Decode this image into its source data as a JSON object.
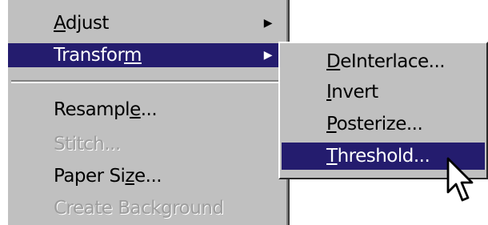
{
  "main_menu": {
    "items": [
      {
        "label": "Adjust",
        "has_submenu": true,
        "state": "normal"
      },
      {
        "label": "Transform",
        "has_submenu": true,
        "state": "selected"
      },
      {
        "label": "Resample...",
        "has_submenu": false,
        "state": "normal"
      },
      {
        "label": "Stitch...",
        "has_submenu": false,
        "state": "disabled"
      },
      {
        "label": "Paper Size...",
        "has_submenu": false,
        "state": "normal"
      },
      {
        "label": "Create Background",
        "has_submenu": false,
        "state": "disabled"
      }
    ]
  },
  "submenu": {
    "items": [
      {
        "label": "DeInterlace...",
        "state": "normal"
      },
      {
        "label": "Invert",
        "state": "normal"
      },
      {
        "label": "Posterize...",
        "state": "normal"
      },
      {
        "label": "Threshold...",
        "state": "selected"
      }
    ]
  },
  "icons": {
    "submenu_arrow": "triangle-right-icon",
    "cursor": "arrow-pointer-icon"
  },
  "colors": {
    "menu_background": "#c0c0c0",
    "highlight": "#241c6e",
    "highlight_text": "#ffffff",
    "disabled_text": "#9d9d9d"
  }
}
